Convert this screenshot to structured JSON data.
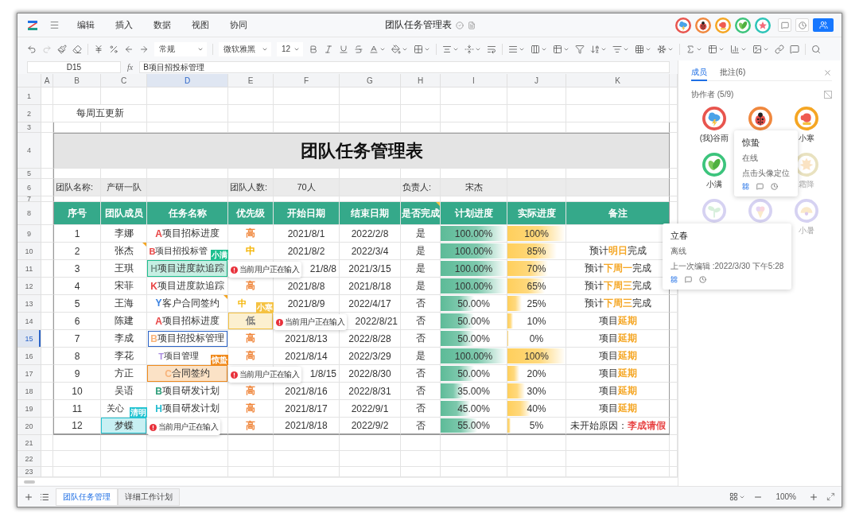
{
  "app": {
    "menus": [
      "编辑",
      "插入",
      "数据",
      "视图",
      "协同"
    ],
    "title": "团队任务管理表",
    "top_avatars": [
      {
        "color": "#e8554e"
      },
      {
        "color": "#f0883e"
      },
      {
        "color": "#f5a623"
      },
      {
        "color": "#3cc47c"
      },
      {
        "color": "#2cc4b8"
      }
    ]
  },
  "toolbar": {
    "number_format": "常规",
    "font": "微软雅黑",
    "font_size": "12"
  },
  "formula_bar": {
    "cell": "D15",
    "fx": "fx",
    "value": "B项目招投标管理"
  },
  "sheet": {
    "columns": [
      {
        "label": "A",
        "selected": false
      },
      {
        "label": "B",
        "selected": false
      },
      {
        "label": "C",
        "selected": false
      },
      {
        "label": "D",
        "selected": true
      },
      {
        "label": "E",
        "selected": false
      },
      {
        "label": "F",
        "selected": false
      },
      {
        "label": "G",
        "selected": false
      },
      {
        "label": "H",
        "selected": false
      },
      {
        "label": "I",
        "selected": false
      },
      {
        "label": "J",
        "selected": false
      },
      {
        "label": "K",
        "selected": false
      }
    ],
    "row_numbers": [
      {
        "label": "1",
        "selected": false
      },
      {
        "label": "2",
        "selected": false
      },
      {
        "label": "3",
        "selected": false
      },
      {
        "label": "4",
        "selected": false
      },
      {
        "label": "5",
        "selected": false
      },
      {
        "label": "6",
        "selected": false
      },
      {
        "label": "7",
        "selected": false
      },
      {
        "label": "8",
        "selected": false
      },
      {
        "label": "9",
        "selected": false
      },
      {
        "label": "10",
        "selected": false
      },
      {
        "label": "11",
        "selected": false
      },
      {
        "label": "12",
        "selected": false
      },
      {
        "label": "13",
        "selected": false
      },
      {
        "label": "14",
        "selected": false
      },
      {
        "label": "15",
        "selected": true
      },
      {
        "label": "16",
        "selected": false
      },
      {
        "label": "17",
        "selected": false
      },
      {
        "label": "18",
        "selected": false
      },
      {
        "label": "19",
        "selected": false
      },
      {
        "label": "20",
        "selected": false
      },
      {
        "label": "21",
        "selected": false
      },
      {
        "label": "22",
        "selected": false
      },
      {
        "label": "23",
        "selected": false
      }
    ],
    "note": "每周五更新",
    "title": "团队任务管理表",
    "info": [
      {
        "label": "团队名称:",
        "value": "产研一队"
      },
      {
        "label": "团队人数:",
        "value": "70人"
      },
      {
        "label": "负责人:",
        "value": "宋杰"
      }
    ],
    "headers": [
      {
        "label": "序号",
        "comment": false
      },
      {
        "label": "团队成员",
        "comment": false
      },
      {
        "label": "任务名称",
        "comment": false
      },
      {
        "label": "优先级",
        "comment": false
      },
      {
        "label": "开始日期",
        "comment": false
      },
      {
        "label": "结束日期",
        "comment": false
      },
      {
        "label": "是否完成",
        "comment": true
      },
      {
        "label": "计划进度",
        "comment": false
      },
      {
        "label": "实际进度",
        "comment": false
      },
      {
        "label": "备注",
        "comment": false
      }
    ],
    "rows": [
      {
        "no": "1",
        "member": "李娜",
        "task": {
          "code": "A",
          "name": "项目招标进度",
          "color": "#e84545"
        },
        "priority": {
          "label": "高",
          "color": "#f0883e"
        },
        "start": "2021/8/1",
        "end": "2022/2/8",
        "done": "是",
        "plan": {
          "text": "100.00%",
          "level": 1
        },
        "actual": {
          "text": "100%",
          "level": 1
        }
      },
      {
        "member_comment": true,
        "no": "2",
        "member": "张杰",
        "task": {
          "code": "B",
          "name": "项目招投标管",
          "color": "#e84545"
        },
        "priority": {
          "label": "中",
          "color": "#f5b400"
        },
        "start": "2021/8/2",
        "end": "2022/3/4",
        "done": "是",
        "plan": {
          "text": "100.00%",
          "level": 1
        },
        "actual": {
          "text": "85%",
          "level": 0.85
        },
        "note": {
          "parts": [
            "预计",
            "明日",
            "完成"
          ],
          "color": "#f5a623"
        }
      },
      {
        "no": "3",
        "member": "王琪",
        "task": {
          "code": "H",
          "name": "项目进度款追踪",
          "color": "#7a9a90"
        },
        "task_edit": {
          "user": "小满",
          "color": "#1dbf8f",
          "typing": "当前用户正在输入"
        },
        "start": "21/8/8",
        "end": "2021/3/15",
        "done": "是",
        "plan": {
          "text": "100.00%",
          "level": 1
        },
        "actual": {
          "text": "70%",
          "level": 0.7
        },
        "note": {
          "parts": [
            "预计",
            "下周一",
            "完成"
          ],
          "color": "#f5a623"
        }
      },
      {
        "no": "4",
        "member": "宋菲",
        "task": {
          "code": "K",
          "name": "项目进度款追踪",
          "color": "#e84545"
        },
        "priority": {
          "label": "高",
          "color": "#f0883e"
        },
        "start": "2021/8/8",
        "end": "2021/8/18",
        "done": "是",
        "plan": {
          "text": "100.00%",
          "level": 1
        },
        "actual": {
          "text": "65%",
          "level": 0.65
        },
        "note": {
          "parts": [
            "预计",
            "下周三",
            "完成"
          ],
          "color": "#f5a623"
        }
      },
      {
        "task_comment": true,
        "no": "5",
        "member": "王海",
        "task": {
          "code": "Y",
          "name": "客户合同签约",
          "color": "#3b82e0"
        },
        "priority": {
          "label": "中",
          "color": "#f5b400"
        },
        "start": "2021/8/9",
        "end": "2022/4/17",
        "done": "否",
        "plan": {
          "text": "50.00%",
          "level": 0.5
        },
        "actual": {
          "text": "25%",
          "level": 0.25
        },
        "note": {
          "parts": [
            "预计",
            "下周三",
            "完成"
          ],
          "color": "#f5a623"
        }
      },
      {
        "no": "6",
        "member": "陈建",
        "task": {
          "code": "A",
          "name": "项目招标进度",
          "color": "#e84545"
        },
        "priority": {
          "label": "低",
          "color": "#777777"
        },
        "priority_edit": {
          "user": "小寒",
          "color": "#f5c242",
          "typing": "当前用户正在输入"
        },
        "end": "2022/8/21",
        "done": "否",
        "plan": {
          "text": "50.00%",
          "level": 0.5
        },
        "actual": {
          "text": "10%",
          "level": 0.1
        },
        "note": {
          "parts": [
            "项目",
            "延期"
          ],
          "color": "#f5a623"
        }
      },
      {
        "no": "7",
        "member": "李成",
        "task": {
          "code": "B",
          "name": "项目招投标管理",
          "color": "#f7b37a"
        },
        "priority": {
          "label": "高",
          "color": "#f0883e"
        },
        "start": "2021/8/13",
        "end": "2022/8/28",
        "done": "否",
        "plan": {
          "text": "50.00%",
          "level": 0.5
        },
        "actual": {
          "text": "0%",
          "level": 0
        },
        "note": {
          "parts": [
            "项目",
            "延期"
          ],
          "color": "#f5a623"
        }
      },
      {
        "no": "8",
        "member": "李花",
        "task": {
          "code": "T",
          "name": "项目管理",
          "color": "#a98be0"
        },
        "priority": {
          "label": "高",
          "color": "#f0883e"
        },
        "start": "2021/8/14",
        "end": "2022/3/29",
        "done": "是",
        "plan": {
          "text": "100.00%",
          "level": 1
        },
        "actual": {
          "text": "100%",
          "level": 1
        },
        "note": {
          "parts": [
            "项目",
            "延期"
          ],
          "color": "#f5a623"
        }
      },
      {
        "no": "9",
        "member": "方正",
        "task": {
          "code": "C",
          "name": "合同签约",
          "color": "#f7b37a"
        },
        "task_edit": {
          "user": "惊蛰",
          "color": "#f08a1c",
          "typing": "当前用户正在输入"
        },
        "start": "1/8/15",
        "end": "2022/8/30",
        "done": "否",
        "plan": {
          "text": "50.00%",
          "level": 0.5
        },
        "actual": {
          "text": "20%",
          "level": 0.2
        },
        "note": {
          "parts": [
            "项目",
            "延期"
          ],
          "color": "#f5a623"
        }
      },
      {
        "no": "10",
        "member": "吴语",
        "task": {
          "code": "B",
          "name": "项目研发计划",
          "color": "#2f9e7a"
        },
        "priority": {
          "label": "高",
          "color": "#f0883e"
        },
        "start": "2021/8/16",
        "end": "2022/8/31",
        "done": "否",
        "plan": {
          "text": "35.00%",
          "level": 0.35
        },
        "actual": {
          "text": "30%",
          "level": 0.3
        },
        "note": {
          "parts": [
            "项目",
            "延期"
          ],
          "color": "#f5a623"
        }
      },
      {
        "no": "11",
        "member": "关心",
        "task": {
          "code": "H",
          "name": "项目研发计划",
          "color": "#22bcd0"
        },
        "priority": {
          "label": "高",
          "color": "#f0883e"
        },
        "start": "2021/8/17",
        "end": "2022/9/1",
        "done": "否",
        "plan": {
          "text": "45.00%",
          "level": 0.45
        },
        "actual": {
          "text": "40%",
          "level": 0.4
        },
        "note": {
          "parts": [
            "项目",
            "延期"
          ],
          "color": "#f5a623"
        }
      },
      {
        "no": "12",
        "member": "梦蝶",
        "member_edit": {
          "user": "清明",
          "color": "#22c3d1",
          "typing": "当前用户正在输入"
        },
        "priority": {
          "label": "高",
          "color": "#f0883e"
        },
        "start": "2021/8/18",
        "end": "2022/9/2",
        "done": "否",
        "plan": {
          "text": "55.00%",
          "level": 0.55
        },
        "actual": {
          "text": "5%",
          "level": 0.05
        },
        "note": {
          "parts": [
            "未开始原因：",
            "李成请假"
          ],
          "color": "#e84545"
        }
      }
    ]
  },
  "panel": {
    "tabs": [
      {
        "label": "成员",
        "selected": true
      },
      {
        "label": "批注(6)",
        "selected": false
      }
    ],
    "heading": "协作者 (5/9)",
    "members": [
      {
        "kind": "avatar",
        "name": "(我)谷雨",
        "online": true,
        "color": "#e8554e"
      },
      {
        "kind": "avatar",
        "online": true,
        "color": "#f0883e"
      },
      {
        "kind": "avatar",
        "name": "小寒",
        "online": true,
        "color": "#f5a623"
      },
      {
        "kind": "avatar",
        "name": "小满",
        "online": true,
        "color": "#3cc47c"
      },
      {
        "kind": "covered"
      },
      {
        "kind": "avatar",
        "name": "霜降",
        "online": false,
        "color": "#e9e2c0"
      },
      {
        "kind": "avatar",
        "online": false,
        "color": "#d6d2f2"
      },
      {
        "kind": "avatar",
        "online": false,
        "color": "#d6d2f2"
      },
      {
        "kind": "avatar",
        "name": "小暑",
        "online": false,
        "color": "#d6d2f2"
      }
    ],
    "popups": [
      {
        "name": "惊蛰",
        "status": "在线",
        "detail": "点击头像定位"
      },
      {
        "name": "立春",
        "status": "离线",
        "detail": "上一次编辑 :2022/3/30 下午5:28"
      }
    ]
  },
  "footer": {
    "sheets": [
      {
        "label": "团队任务管理",
        "selected": true
      },
      {
        "label": "详细工作计划",
        "selected": false
      }
    ],
    "zoom": "100%"
  }
}
